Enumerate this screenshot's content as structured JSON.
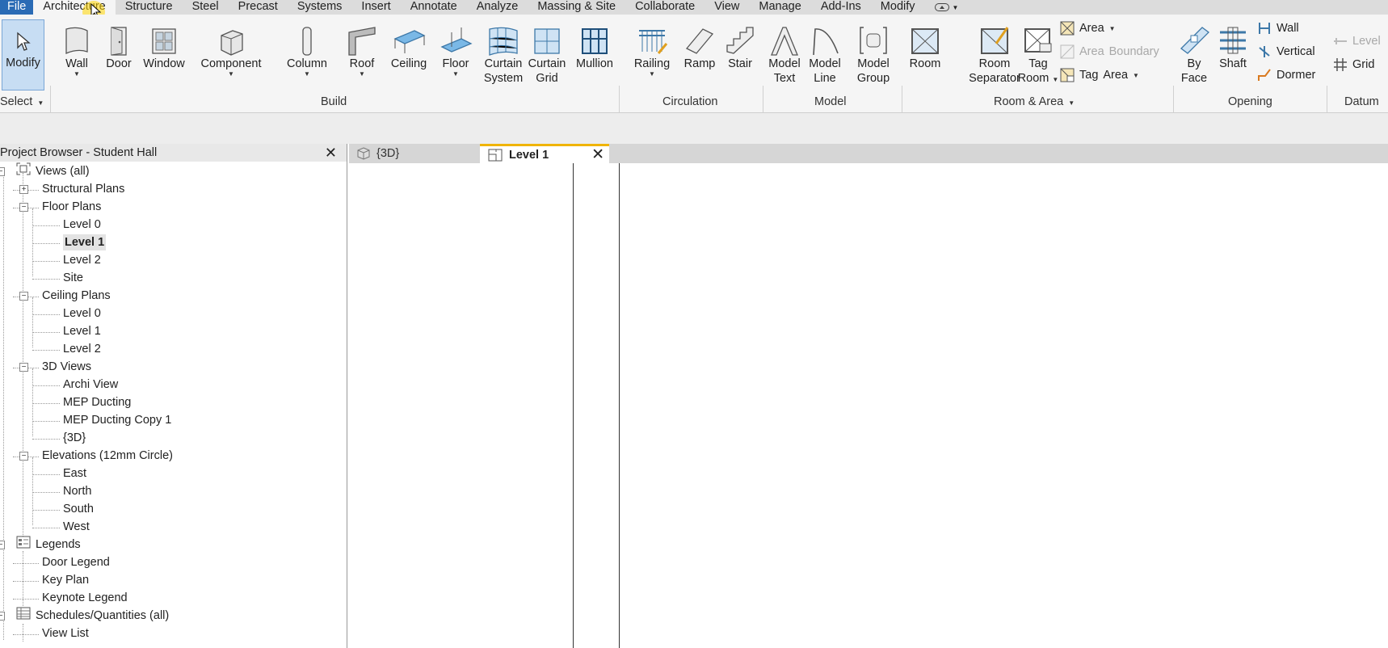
{
  "menu": {
    "tabs": [
      "File",
      "Architecture",
      "Structure",
      "Steel",
      "Precast",
      "Systems",
      "Insert",
      "Annotate",
      "Analyze",
      "Massing & Site",
      "Collaborate",
      "View",
      "Manage",
      "Add-Ins",
      "Modify"
    ],
    "active": "Architecture"
  },
  "ribbon": {
    "select": {
      "modify": "Modify",
      "panel": "Select"
    },
    "build": {
      "panel": "Build",
      "wall": "Wall",
      "door": "Door",
      "window": "Window",
      "component": "Component",
      "column": "Column",
      "roof": "Roof",
      "ceiling": "Ceiling",
      "floor": "Floor",
      "curtain_system_1": "Curtain",
      "curtain_system_2": "System",
      "curtain_grid_1": "Curtain",
      "curtain_grid_2": "Grid",
      "mullion": "Mullion"
    },
    "circulation": {
      "panel": "Circulation",
      "railing": "Railing",
      "ramp": "Ramp",
      "stair": "Stair"
    },
    "model": {
      "panel": "Model",
      "model_text_1": "Model",
      "model_text_2": "Text",
      "model_line_1": "Model",
      "model_line_2": "Line",
      "model_group_1": "Model",
      "model_group_2": "Group"
    },
    "room_area": {
      "panel": "Room & Area",
      "room": "Room",
      "room_separator_1": "Room",
      "room_separator_2": "Separator",
      "tag_room_1": "Tag",
      "tag_room_2": "Room",
      "area": "Area",
      "area_boundary_1": "Area",
      "area_boundary_2": "Boundary",
      "tag_area_1": "Tag",
      "tag_area_2": "Area"
    },
    "opening": {
      "panel": "Opening",
      "by_face_1": "By",
      "by_face_2": "Face",
      "shaft": "Shaft",
      "wall": "Wall",
      "vertical": "Vertical",
      "dormer": "Dormer"
    },
    "datum": {
      "panel": "Datum",
      "level": "Level",
      "grid": "Grid"
    }
  },
  "browser": {
    "title": "Project Browser - Student Hall",
    "close": "✕",
    "items": [
      {
        "label": "Views (all)"
      },
      {
        "label": "Structural Plans"
      },
      {
        "label": "Floor Plans"
      },
      {
        "label": "Level 0"
      },
      {
        "label": "Level 1"
      },
      {
        "label": "Level 2"
      },
      {
        "label": "Site"
      },
      {
        "label": "Ceiling Plans"
      },
      {
        "label": "Level 0"
      },
      {
        "label": "Level 1"
      },
      {
        "label": "Level 2"
      },
      {
        "label": "3D Views"
      },
      {
        "label": "Archi View"
      },
      {
        "label": "MEP Ducting"
      },
      {
        "label": "MEP Ducting Copy 1"
      },
      {
        "label": "{3D}"
      },
      {
        "label": "Elevations (12mm Circle)"
      },
      {
        "label": "East"
      },
      {
        "label": "North"
      },
      {
        "label": "South"
      },
      {
        "label": "West"
      },
      {
        "label": "Legends"
      },
      {
        "label": "Door Legend"
      },
      {
        "label": "Key Plan"
      },
      {
        "label": "Keynote Legend"
      },
      {
        "label": "Schedules/Quantities (all)"
      },
      {
        "label": "View List"
      }
    ],
    "selected": "Level 1"
  },
  "view_tabs": [
    {
      "label": "{3D}"
    },
    {
      "label": "Level 1"
    }
  ],
  "view_tab_close": "✕"
}
